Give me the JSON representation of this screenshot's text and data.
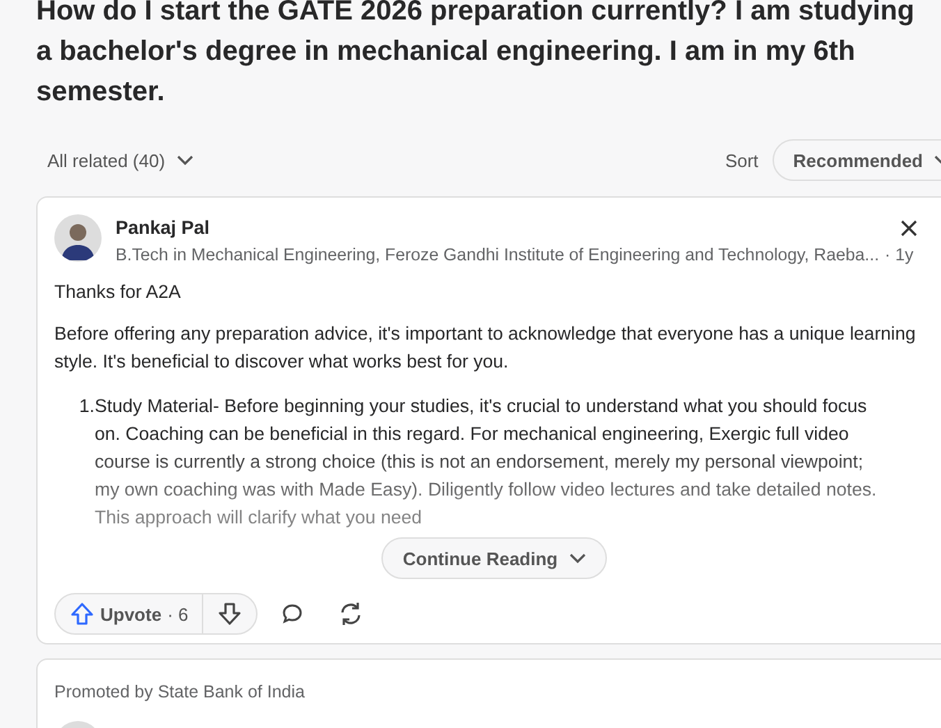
{
  "question": {
    "title": "How do I start the GATE 2026 preparation currently? I am studying a bachelor's degree in mechanical engineering. I am in my 6th semester."
  },
  "filter": {
    "label": "All related (40)"
  },
  "sort": {
    "label": "Sort",
    "value": "Recommended"
  },
  "answers": [
    {
      "author": "Pankaj Pal",
      "credential": "B.Tech in Mechanical Engineering, Feroze Gandhi Institute of Engineering and Technology, Raeba...",
      "time": "· 1y",
      "greeting": "Thanks for A2A",
      "paragraphs": [
        "Before offering any preparation advice, it's important to acknowledge that everyone has a unique learning style. It's beneficial to discover what works best for you."
      ],
      "list": [
        {
          "number": "1.",
          "text": "Study Material- Before beginning your studies, it's crucial to understand what you should focus on. Coaching can be beneficial in this regard. For mechanical engineering, Exergic full video course is currently a strong choice (this is not an endorsement, merely my personal viewpoint; my own coaching was with Made Easy). Diligently follow video lectures and take detailed notes. This approach will clarify what you need"
        }
      ],
      "continue": "Continue Reading",
      "upvote": {
        "label": "Upvote",
        "count": "· 6"
      }
    }
  ],
  "promoted": {
    "label": "Promoted by State Bank of India"
  }
}
